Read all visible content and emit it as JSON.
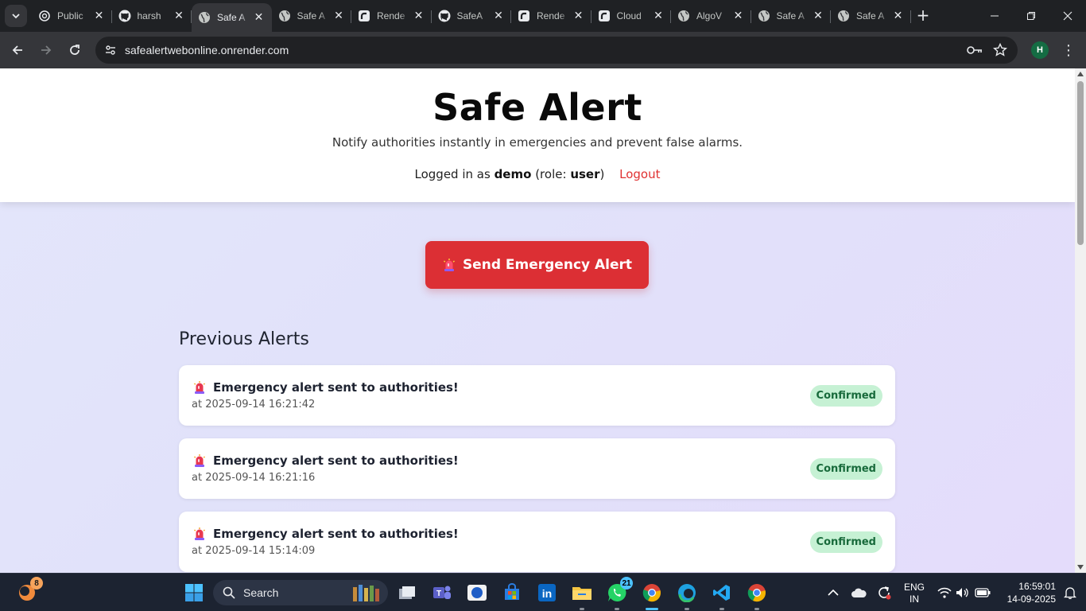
{
  "browser": {
    "tabs": [
      {
        "title": "Public",
        "icon": "openai-icon",
        "active": false
      },
      {
        "title": "harsh",
        "icon": "github-icon",
        "active": false
      },
      {
        "title": "Safe A",
        "icon": "globe-icon",
        "active": true
      },
      {
        "title": "Safe A",
        "icon": "globe-icon",
        "active": false
      },
      {
        "title": "Rende",
        "icon": "render-icon",
        "active": false
      },
      {
        "title": "SafeA",
        "icon": "github-icon",
        "active": false
      },
      {
        "title": "Rende",
        "icon": "render-icon",
        "active": false
      },
      {
        "title": "Cloud",
        "icon": "render-icon",
        "active": false
      },
      {
        "title": "AlgoV",
        "icon": "globe-icon",
        "active": false
      },
      {
        "title": "Safe A",
        "icon": "globe-icon",
        "active": false
      },
      {
        "title": "Safe A",
        "icon": "globe-icon",
        "active": false
      }
    ],
    "close_glyph": "✕",
    "new_tab_glyph": "+",
    "url": "safealertwebonline.onrender.com",
    "profile_initial": "H"
  },
  "page": {
    "title": "Safe Alert",
    "tagline": "Notify authorities instantly in emergencies and prevent false alarms.",
    "login_prefix": "Logged in as",
    "username": "demo",
    "role_prefix": "(role:",
    "role": "user",
    "role_suffix": ")",
    "logout_label": "Logout",
    "send_button_label": "Send Emergency Alert",
    "section_title": "Previous Alerts",
    "alerts": [
      {
        "message": "Emergency alert sent to authorities!",
        "time": "at 2025-09-14 16:21:42",
        "status": "Confirmed"
      },
      {
        "message": "Emergency alert sent to authorities!",
        "time": "at 2025-09-14 16:21:16",
        "status": "Confirmed"
      },
      {
        "message": "Emergency alert sent to authorities!",
        "time": "at 2025-09-14 15:14:09",
        "status": "Confirmed"
      }
    ]
  },
  "taskbar": {
    "search_label": "Search",
    "widget_badge": "8",
    "whatsapp_badge": "21",
    "lang_line1": "ENG",
    "lang_line2": "IN",
    "time": "16:59:01",
    "date": "14-09-2025"
  },
  "colors": {
    "accent_red": "#dc2f34",
    "logout_red": "#e03131",
    "confirmed_bg": "#c6f1d4",
    "confirmed_text": "#186a3b"
  }
}
